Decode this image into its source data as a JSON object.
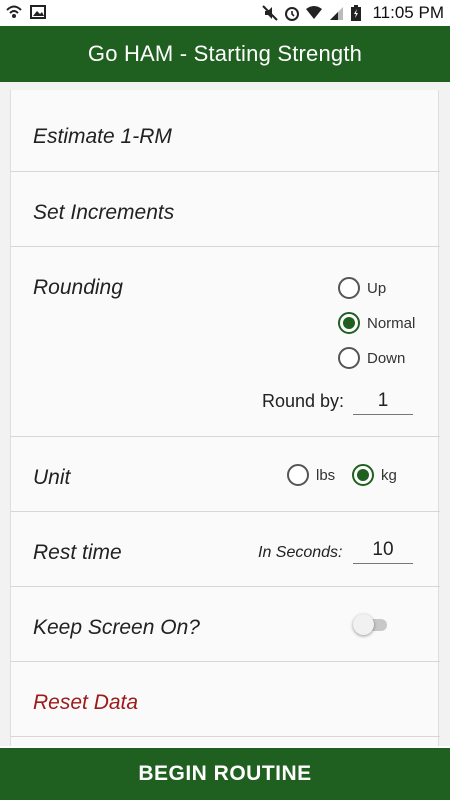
{
  "status_bar": {
    "time": "11:05 PM",
    "left_icons": [
      "wifi-call-icon",
      "image-icon"
    ],
    "right_icons": [
      "mute-icon",
      "alarm-icon",
      "wifi-icon",
      "signal-icon",
      "battery-icon"
    ]
  },
  "app_bar": {
    "title": "Go HAM - Starting Strength"
  },
  "settings": {
    "estimate": {
      "label": "Estimate 1-RM"
    },
    "increments": {
      "label": "Set Increments"
    },
    "rounding": {
      "label": "Rounding",
      "options": [
        "Up",
        "Normal",
        "Down"
      ],
      "selected": "Normal",
      "round_by_label": "Round by:",
      "round_by_value": "1"
    },
    "unit": {
      "label": "Unit",
      "options": [
        "lbs",
        "kg"
      ],
      "selected": "kg"
    },
    "rest": {
      "label": "Rest time",
      "seconds_label": "In Seconds:",
      "value": "10"
    },
    "screen": {
      "label": "Keep Screen On?",
      "enabled": false
    },
    "reset": {
      "label": "Reset Data"
    }
  },
  "footer": {
    "begin_label": "BEGIN ROUTINE"
  },
  "colors": {
    "primary": "#1f5f1f",
    "reset_text": "#9b1a1a"
  }
}
